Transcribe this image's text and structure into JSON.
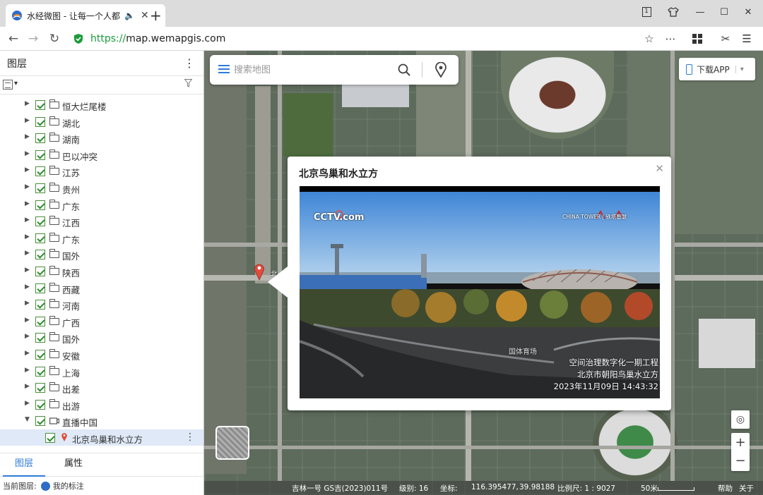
{
  "browser": {
    "tab_title": "水经微图 - 让每一个人都",
    "mute_icon": "speaker-icon",
    "url_scheme": "https://",
    "url_host": "map.wemapgis.com"
  },
  "left_panel": {
    "title": "图层",
    "layers": [
      {
        "label": "恒大烂尾楼"
      },
      {
        "label": "湖北"
      },
      {
        "label": "湖南"
      },
      {
        "label": "巴以冲突"
      },
      {
        "label": "江苏"
      },
      {
        "label": "贵州"
      },
      {
        "label": "广东"
      },
      {
        "label": "江西"
      },
      {
        "label": "广东"
      },
      {
        "label": "国外"
      },
      {
        "label": "陕西"
      },
      {
        "label": "西藏"
      },
      {
        "label": "河南"
      },
      {
        "label": "广西"
      },
      {
        "label": "国外"
      },
      {
        "label": "安徽"
      },
      {
        "label": "上海"
      },
      {
        "label": "出差"
      },
      {
        "label": "出游"
      },
      {
        "label": "直播中国"
      }
    ],
    "selected_child": "北京鸟巢和水立方",
    "tabs": [
      "图层",
      "属性"
    ],
    "status_label": "当前图层:",
    "status_value": "我的标注"
  },
  "map": {
    "search_placeholder": "搜索地图",
    "download_app": "下载APP",
    "marker_label": "北",
    "popup": {
      "title": "北京鸟巢和水立方",
      "video": {
        "logo_text": "CCTV.com",
        "partner_text": "CHINA TOWER | 铁塔智联",
        "caption_line1": "空间治理数字化一期工程",
        "caption_line2": "北京市朝阳鸟巢水立方",
        "timestamp": "2023年11月09日 14:43:32",
        "watermark": "国体育场"
      }
    },
    "status": {
      "source": "吉林一号 GS吉(2023)011号",
      "zoom": "级别: 16",
      "coords_label": "坐标:",
      "lon": "116.395477,",
      "lat": "39.98188",
      "scale": "比例尺: 1 : 9027",
      "scale_bar": "50米",
      "help": "帮助",
      "about": "关于"
    }
  },
  "colors": {
    "accent": "#2f7bd6",
    "check": "#2e8b2e",
    "url_green": "#1a9b3a"
  }
}
